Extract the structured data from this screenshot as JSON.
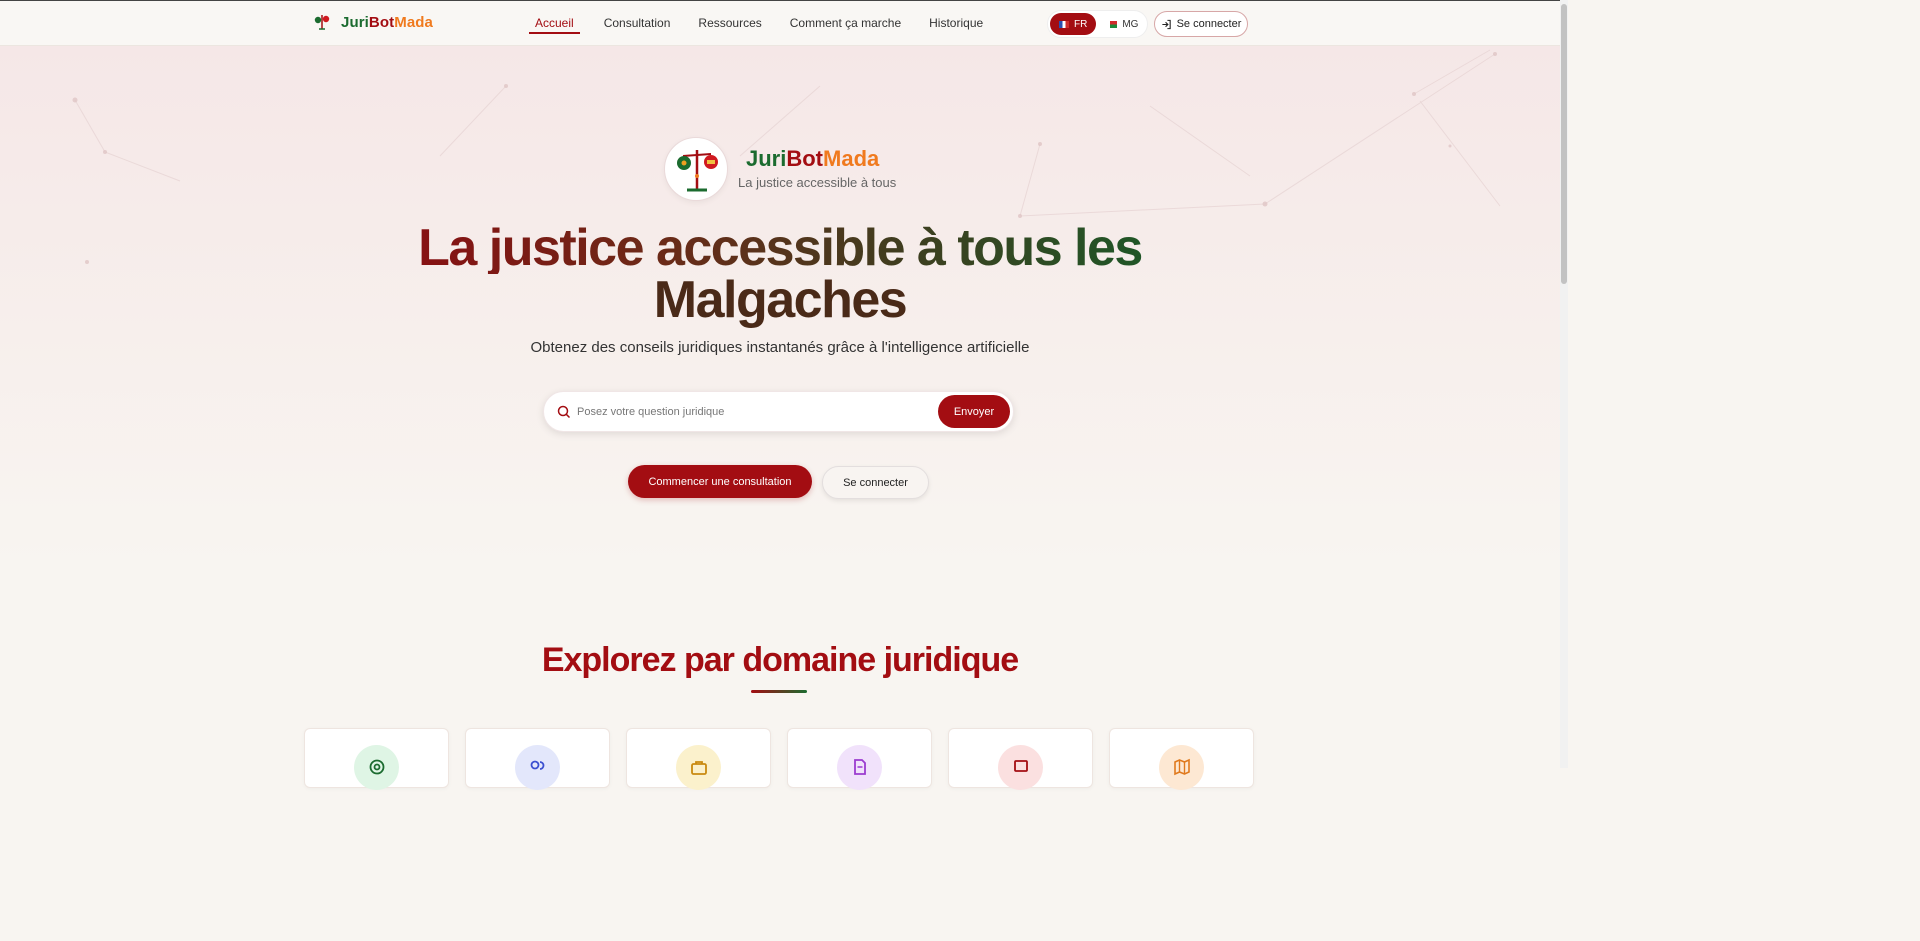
{
  "brand": {
    "juri": "Juri",
    "bot": "Bot",
    "mada": "Mada"
  },
  "nav": {
    "items": [
      {
        "label": "Accueil",
        "active": true
      },
      {
        "label": "Consultation"
      },
      {
        "label": "Ressources"
      },
      {
        "label": "Comment ça marche"
      },
      {
        "label": "Historique"
      }
    ],
    "lang": {
      "fr": "FR",
      "mg": "MG",
      "selected": "FR"
    },
    "login_label": "Se connecter"
  },
  "hero": {
    "tagline": "La justice accessible à tous",
    "headline_line1": "La justice accessible à tous les",
    "headline_line2": "Malgaches",
    "subtitle": "Obtenez des conseils juridiques instantanés grâce à l'intelligence artificielle",
    "search_placeholder": "Posez votre question juridique",
    "send_label": "Envoyer",
    "cta_primary": "Commencer une consultation",
    "cta_secondary": "Se connecter"
  },
  "section": {
    "title": "Explorez par domaine juridique",
    "cards": [
      {
        "icon": "target-icon",
        "color": "#1b6b2f",
        "bg": "#dff5e5"
      },
      {
        "icon": "users-icon",
        "color": "#3b4fd0",
        "bg": "#e3e7fb"
      },
      {
        "icon": "briefcase-icon",
        "color": "#c98a10",
        "bg": "#fbf1cc"
      },
      {
        "icon": "document-icon",
        "color": "#9b3bd0",
        "bg": "#f1e2fb"
      },
      {
        "icon": "monitor-icon",
        "color": "#a30d12",
        "bg": "#fbe0e0"
      },
      {
        "icon": "map-icon",
        "color": "#e07a1e",
        "bg": "#fde8d3"
      }
    ]
  },
  "colors": {
    "primary": "#a30d12",
    "green": "#1b6b2f",
    "orange": "#f07a1e"
  }
}
